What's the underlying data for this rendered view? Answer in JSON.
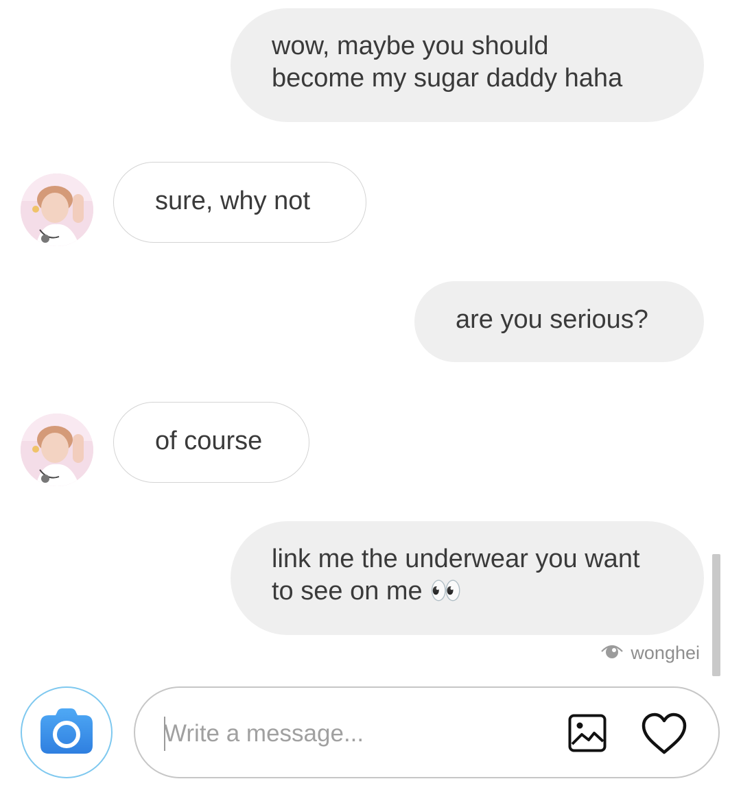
{
  "thread": {
    "messages": [
      {
        "id": "m1",
        "direction": "sent",
        "text": "wow, maybe you should\nbecome my sugar daddy haha"
      },
      {
        "id": "m2",
        "direction": "received",
        "text": "sure, why not"
      },
      {
        "id": "m3",
        "direction": "sent",
        "text": "are you serious?"
      },
      {
        "id": "m4",
        "direction": "received",
        "text": "of course"
      },
      {
        "id": "m5",
        "direction": "sent",
        "text": "link me the underwear you want\nto see on me 👀"
      }
    ],
    "seen_by": "wonghei",
    "seen_icon": "eye-icon"
  },
  "composer": {
    "camera_icon": "camera-icon",
    "placeholder": "Write a message...",
    "value": "",
    "gallery_icon": "image-icon",
    "like_icon": "heart-icon",
    "accent_color": "#3897f0"
  }
}
